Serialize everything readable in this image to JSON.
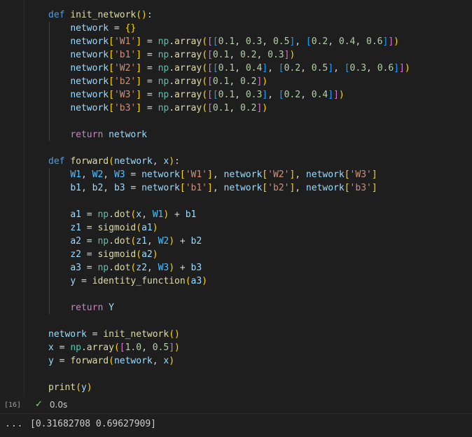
{
  "cell": {
    "execution_count": "[16]",
    "status_icon": "check-icon",
    "duration": "0.0s",
    "output_menu": "...",
    "output_text": "[0.31682708 0.69627909]"
  },
  "code_lines": [
    [
      [
        "kw",
        "def"
      ],
      [
        "op",
        " "
      ],
      [
        "fn",
        "init_network"
      ],
      [
        "b1",
        "()"
      ],
      [
        "op",
        ":"
      ]
    ],
    [
      [
        "op",
        "    "
      ],
      [
        "var",
        "network"
      ],
      [
        "op",
        " = "
      ],
      [
        "b1",
        "{}"
      ]
    ],
    [
      [
        "op",
        "    "
      ],
      [
        "var",
        "network"
      ],
      [
        "b1",
        "["
      ],
      [
        "str",
        "'W1'"
      ],
      [
        "b1",
        "]"
      ],
      [
        "op",
        " = "
      ],
      [
        "mod",
        "np"
      ],
      [
        "op",
        "."
      ],
      [
        "fn",
        "array"
      ],
      [
        "b1",
        "("
      ],
      [
        "b2",
        "["
      ],
      [
        "b3",
        "["
      ],
      [
        "num",
        "0.1"
      ],
      [
        "op",
        ", "
      ],
      [
        "num",
        "0.3"
      ],
      [
        "op",
        ", "
      ],
      [
        "num",
        "0.5"
      ],
      [
        "b3",
        "]"
      ],
      [
        "op",
        ", "
      ],
      [
        "b3",
        "["
      ],
      [
        "num",
        "0.2"
      ],
      [
        "op",
        ", "
      ],
      [
        "num",
        "0.4"
      ],
      [
        "op",
        ", "
      ],
      [
        "num",
        "0.6"
      ],
      [
        "b3",
        "]"
      ],
      [
        "b2",
        "]"
      ],
      [
        "b1",
        ")"
      ]
    ],
    [
      [
        "op",
        "    "
      ],
      [
        "var",
        "network"
      ],
      [
        "b1",
        "["
      ],
      [
        "str",
        "'b1'"
      ],
      [
        "b1",
        "]"
      ],
      [
        "op",
        " = "
      ],
      [
        "mod",
        "np"
      ],
      [
        "op",
        "."
      ],
      [
        "fn",
        "array"
      ],
      [
        "b1",
        "("
      ],
      [
        "b2",
        "["
      ],
      [
        "num",
        "0.1"
      ],
      [
        "op",
        ", "
      ],
      [
        "num",
        "0.2"
      ],
      [
        "op",
        ", "
      ],
      [
        "num",
        "0.3"
      ],
      [
        "b2",
        "]"
      ],
      [
        "b1",
        ")"
      ]
    ],
    [
      [
        "op",
        "    "
      ],
      [
        "var",
        "network"
      ],
      [
        "b1",
        "["
      ],
      [
        "str",
        "'W2'"
      ],
      [
        "b1",
        "]"
      ],
      [
        "op",
        " = "
      ],
      [
        "mod",
        "np"
      ],
      [
        "op",
        "."
      ],
      [
        "fn",
        "array"
      ],
      [
        "b1",
        "("
      ],
      [
        "b2",
        "["
      ],
      [
        "b3",
        "["
      ],
      [
        "num",
        "0.1"
      ],
      [
        "op",
        ", "
      ],
      [
        "num",
        "0.4"
      ],
      [
        "b3",
        "]"
      ],
      [
        "op",
        ", "
      ],
      [
        "b3",
        "["
      ],
      [
        "num",
        "0.2"
      ],
      [
        "op",
        ", "
      ],
      [
        "num",
        "0.5"
      ],
      [
        "b3",
        "]"
      ],
      [
        "op",
        ", "
      ],
      [
        "b3",
        "["
      ],
      [
        "num",
        "0.3"
      ],
      [
        "op",
        ", "
      ],
      [
        "num",
        "0.6"
      ],
      [
        "b3",
        "]"
      ],
      [
        "b2",
        "]"
      ],
      [
        "b1",
        ")"
      ]
    ],
    [
      [
        "op",
        "    "
      ],
      [
        "var",
        "network"
      ],
      [
        "b1",
        "["
      ],
      [
        "str",
        "'b2'"
      ],
      [
        "b1",
        "]"
      ],
      [
        "op",
        " = "
      ],
      [
        "mod",
        "np"
      ],
      [
        "op",
        "."
      ],
      [
        "fn",
        "array"
      ],
      [
        "b1",
        "("
      ],
      [
        "b2",
        "["
      ],
      [
        "num",
        "0.1"
      ],
      [
        "op",
        ", "
      ],
      [
        "num",
        "0.2"
      ],
      [
        "b2",
        "]"
      ],
      [
        "b1",
        ")"
      ]
    ],
    [
      [
        "op",
        "    "
      ],
      [
        "var",
        "network"
      ],
      [
        "b1",
        "["
      ],
      [
        "str",
        "'W3'"
      ],
      [
        "b1",
        "]"
      ],
      [
        "op",
        " = "
      ],
      [
        "mod",
        "np"
      ],
      [
        "op",
        "."
      ],
      [
        "fn",
        "array"
      ],
      [
        "b1",
        "("
      ],
      [
        "b2",
        "["
      ],
      [
        "b3",
        "["
      ],
      [
        "num",
        "0.1"
      ],
      [
        "op",
        ", "
      ],
      [
        "num",
        "0.3"
      ],
      [
        "b3",
        "]"
      ],
      [
        "op",
        ", "
      ],
      [
        "b3",
        "["
      ],
      [
        "num",
        "0.2"
      ],
      [
        "op",
        ", "
      ],
      [
        "num",
        "0.4"
      ],
      [
        "b3",
        "]"
      ],
      [
        "b2",
        "]"
      ],
      [
        "b1",
        ")"
      ]
    ],
    [
      [
        "op",
        "    "
      ],
      [
        "var",
        "network"
      ],
      [
        "b1",
        "["
      ],
      [
        "str",
        "'b3'"
      ],
      [
        "b1",
        "]"
      ],
      [
        "op",
        " = "
      ],
      [
        "mod",
        "np"
      ],
      [
        "op",
        "."
      ],
      [
        "fn",
        "array"
      ],
      [
        "b1",
        "("
      ],
      [
        "b2",
        "["
      ],
      [
        "num",
        "0.1"
      ],
      [
        "op",
        ", "
      ],
      [
        "num",
        "0.2"
      ],
      [
        "b2",
        "]"
      ],
      [
        "b1",
        ")"
      ]
    ],
    [],
    [
      [
        "op",
        "    "
      ],
      [
        "kw2",
        "return"
      ],
      [
        "op",
        " "
      ],
      [
        "var",
        "network"
      ]
    ],
    [],
    [
      [
        "kw",
        "def"
      ],
      [
        "op",
        " "
      ],
      [
        "fn",
        "forward"
      ],
      [
        "b1",
        "("
      ],
      [
        "var",
        "network"
      ],
      [
        "op",
        ", "
      ],
      [
        "var",
        "x"
      ],
      [
        "b1",
        ")"
      ],
      [
        "op",
        ":"
      ]
    ],
    [
      [
        "op",
        "    "
      ],
      [
        "const",
        "W1"
      ],
      [
        "op",
        ", "
      ],
      [
        "const",
        "W2"
      ],
      [
        "op",
        ", "
      ],
      [
        "const",
        "W3"
      ],
      [
        "op",
        " = "
      ],
      [
        "var",
        "network"
      ],
      [
        "b1",
        "["
      ],
      [
        "str",
        "'W1'"
      ],
      [
        "b1",
        "]"
      ],
      [
        "op",
        ", "
      ],
      [
        "var",
        "network"
      ],
      [
        "b1",
        "["
      ],
      [
        "str",
        "'W2'"
      ],
      [
        "b1",
        "]"
      ],
      [
        "op",
        ", "
      ],
      [
        "var",
        "network"
      ],
      [
        "b1",
        "["
      ],
      [
        "str",
        "'W3'"
      ],
      [
        "b1",
        "]"
      ]
    ],
    [
      [
        "op",
        "    "
      ],
      [
        "var",
        "b1"
      ],
      [
        "op",
        ", "
      ],
      [
        "var",
        "b2"
      ],
      [
        "op",
        ", "
      ],
      [
        "var",
        "b3"
      ],
      [
        "op",
        " = "
      ],
      [
        "var",
        "network"
      ],
      [
        "b1",
        "["
      ],
      [
        "str",
        "'b1'"
      ],
      [
        "b1",
        "]"
      ],
      [
        "op",
        ", "
      ],
      [
        "var",
        "network"
      ],
      [
        "b1",
        "["
      ],
      [
        "str",
        "'b2'"
      ],
      [
        "b1",
        "]"
      ],
      [
        "op",
        ", "
      ],
      [
        "var",
        "network"
      ],
      [
        "b1",
        "["
      ],
      [
        "str",
        "'b3'"
      ],
      [
        "b1",
        "]"
      ]
    ],
    [],
    [
      [
        "op",
        "    "
      ],
      [
        "var",
        "a1"
      ],
      [
        "op",
        " = "
      ],
      [
        "mod",
        "np"
      ],
      [
        "op",
        "."
      ],
      [
        "fn",
        "dot"
      ],
      [
        "b1",
        "("
      ],
      [
        "var",
        "x"
      ],
      [
        "op",
        ", "
      ],
      [
        "const",
        "W1"
      ],
      [
        "b1",
        ")"
      ],
      [
        "op",
        " + "
      ],
      [
        "var",
        "b1"
      ]
    ],
    [
      [
        "op",
        "    "
      ],
      [
        "var",
        "z1"
      ],
      [
        "op",
        " = "
      ],
      [
        "fn",
        "sigmoid"
      ],
      [
        "b1",
        "("
      ],
      [
        "var",
        "a1"
      ],
      [
        "b1",
        ")"
      ]
    ],
    [
      [
        "op",
        "    "
      ],
      [
        "var",
        "a2"
      ],
      [
        "op",
        " = "
      ],
      [
        "mod",
        "np"
      ],
      [
        "op",
        "."
      ],
      [
        "fn",
        "dot"
      ],
      [
        "b1",
        "("
      ],
      [
        "var",
        "z1"
      ],
      [
        "op",
        ", "
      ],
      [
        "const",
        "W2"
      ],
      [
        "b1",
        ")"
      ],
      [
        "op",
        " + "
      ],
      [
        "var",
        "b2"
      ]
    ],
    [
      [
        "op",
        "    "
      ],
      [
        "var",
        "z2"
      ],
      [
        "op",
        " = "
      ],
      [
        "fn",
        "sigmoid"
      ],
      [
        "b1",
        "("
      ],
      [
        "var",
        "a2"
      ],
      [
        "b1",
        ")"
      ]
    ],
    [
      [
        "op",
        "    "
      ],
      [
        "var",
        "a3"
      ],
      [
        "op",
        " = "
      ],
      [
        "mod",
        "np"
      ],
      [
        "op",
        "."
      ],
      [
        "fn",
        "dot"
      ],
      [
        "b1",
        "("
      ],
      [
        "var",
        "z2"
      ],
      [
        "op",
        ", "
      ],
      [
        "const",
        "W3"
      ],
      [
        "b1",
        ")"
      ],
      [
        "op",
        " + "
      ],
      [
        "var",
        "b3"
      ]
    ],
    [
      [
        "op",
        "    "
      ],
      [
        "var",
        "y"
      ],
      [
        "op",
        " = "
      ],
      [
        "fn",
        "identity_function"
      ],
      [
        "b1",
        "("
      ],
      [
        "var",
        "a3"
      ],
      [
        "b1",
        ")"
      ]
    ],
    [],
    [
      [
        "op",
        "    "
      ],
      [
        "kw2",
        "return"
      ],
      [
        "op",
        " "
      ],
      [
        "var",
        "Y"
      ]
    ],
    [],
    [
      [
        "var",
        "network"
      ],
      [
        "op",
        " = "
      ],
      [
        "fn",
        "init_network"
      ],
      [
        "b1",
        "()"
      ]
    ],
    [
      [
        "var",
        "x"
      ],
      [
        "op",
        " = "
      ],
      [
        "mod",
        "np"
      ],
      [
        "op",
        "."
      ],
      [
        "fn",
        "array"
      ],
      [
        "b1",
        "("
      ],
      [
        "b2",
        "["
      ],
      [
        "num",
        "1.0"
      ],
      [
        "op",
        ", "
      ],
      [
        "num",
        "0.5"
      ],
      [
        "b2",
        "]"
      ],
      [
        "b1",
        ")"
      ]
    ],
    [
      [
        "var",
        "y"
      ],
      [
        "op",
        " = "
      ],
      [
        "fn",
        "forward"
      ],
      [
        "b1",
        "("
      ],
      [
        "var",
        "network"
      ],
      [
        "op",
        ", "
      ],
      [
        "var",
        "x"
      ],
      [
        "b1",
        ")"
      ]
    ],
    [],
    [
      [
        "fn",
        "print"
      ],
      [
        "b1",
        "("
      ],
      [
        "var",
        "y"
      ],
      [
        "b1",
        ")"
      ]
    ]
  ]
}
